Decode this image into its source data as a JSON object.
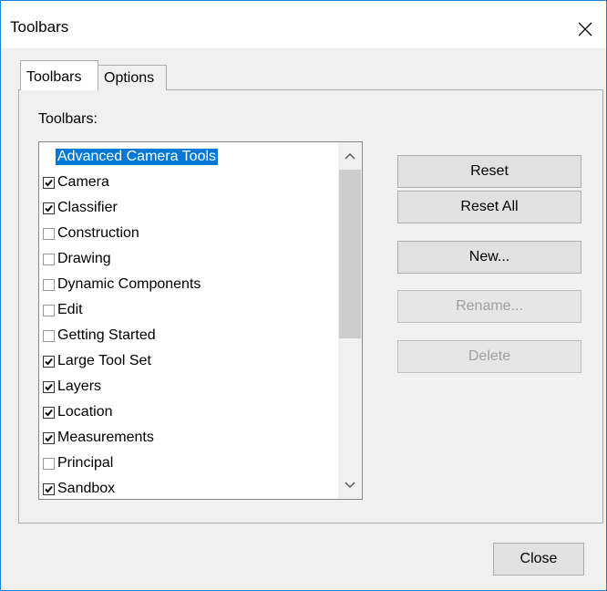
{
  "window": {
    "title": "Toolbars"
  },
  "tabs": [
    {
      "label": "Toolbars",
      "active": true
    },
    {
      "label": "Options",
      "active": false
    }
  ],
  "list": {
    "label": "Toolbars:",
    "items": [
      {
        "label": "Advanced Camera Tools",
        "checked": false,
        "selected": true
      },
      {
        "label": "Camera",
        "checked": true,
        "selected": false
      },
      {
        "label": "Classifier",
        "checked": true,
        "selected": false
      },
      {
        "label": "Construction",
        "checked": false,
        "selected": false
      },
      {
        "label": "Drawing",
        "checked": false,
        "selected": false
      },
      {
        "label": "Dynamic Components",
        "checked": false,
        "selected": false
      },
      {
        "label": "Edit",
        "checked": false,
        "selected": false
      },
      {
        "label": "Getting Started",
        "checked": false,
        "selected": false
      },
      {
        "label": "Large Tool Set",
        "checked": true,
        "selected": false
      },
      {
        "label": "Layers",
        "checked": true,
        "selected": false
      },
      {
        "label": "Location",
        "checked": true,
        "selected": false
      },
      {
        "label": "Measurements",
        "checked": true,
        "selected": false
      },
      {
        "label": "Principal",
        "checked": false,
        "selected": false
      },
      {
        "label": "Sandbox",
        "checked": true,
        "selected": false
      }
    ]
  },
  "buttons": {
    "reset": {
      "label": "Reset",
      "enabled": true
    },
    "reset_all": {
      "label": "Reset All",
      "enabled": true
    },
    "new": {
      "label": "New...",
      "enabled": true
    },
    "rename": {
      "label": "Rename...",
      "enabled": false
    },
    "delete": {
      "label": "Delete",
      "enabled": false
    },
    "close": {
      "label": "Close",
      "enabled": true
    }
  },
  "colors": {
    "selection": "#0078d7",
    "window_border": "#1883d7",
    "disabled_text": "#a0a0a0"
  }
}
